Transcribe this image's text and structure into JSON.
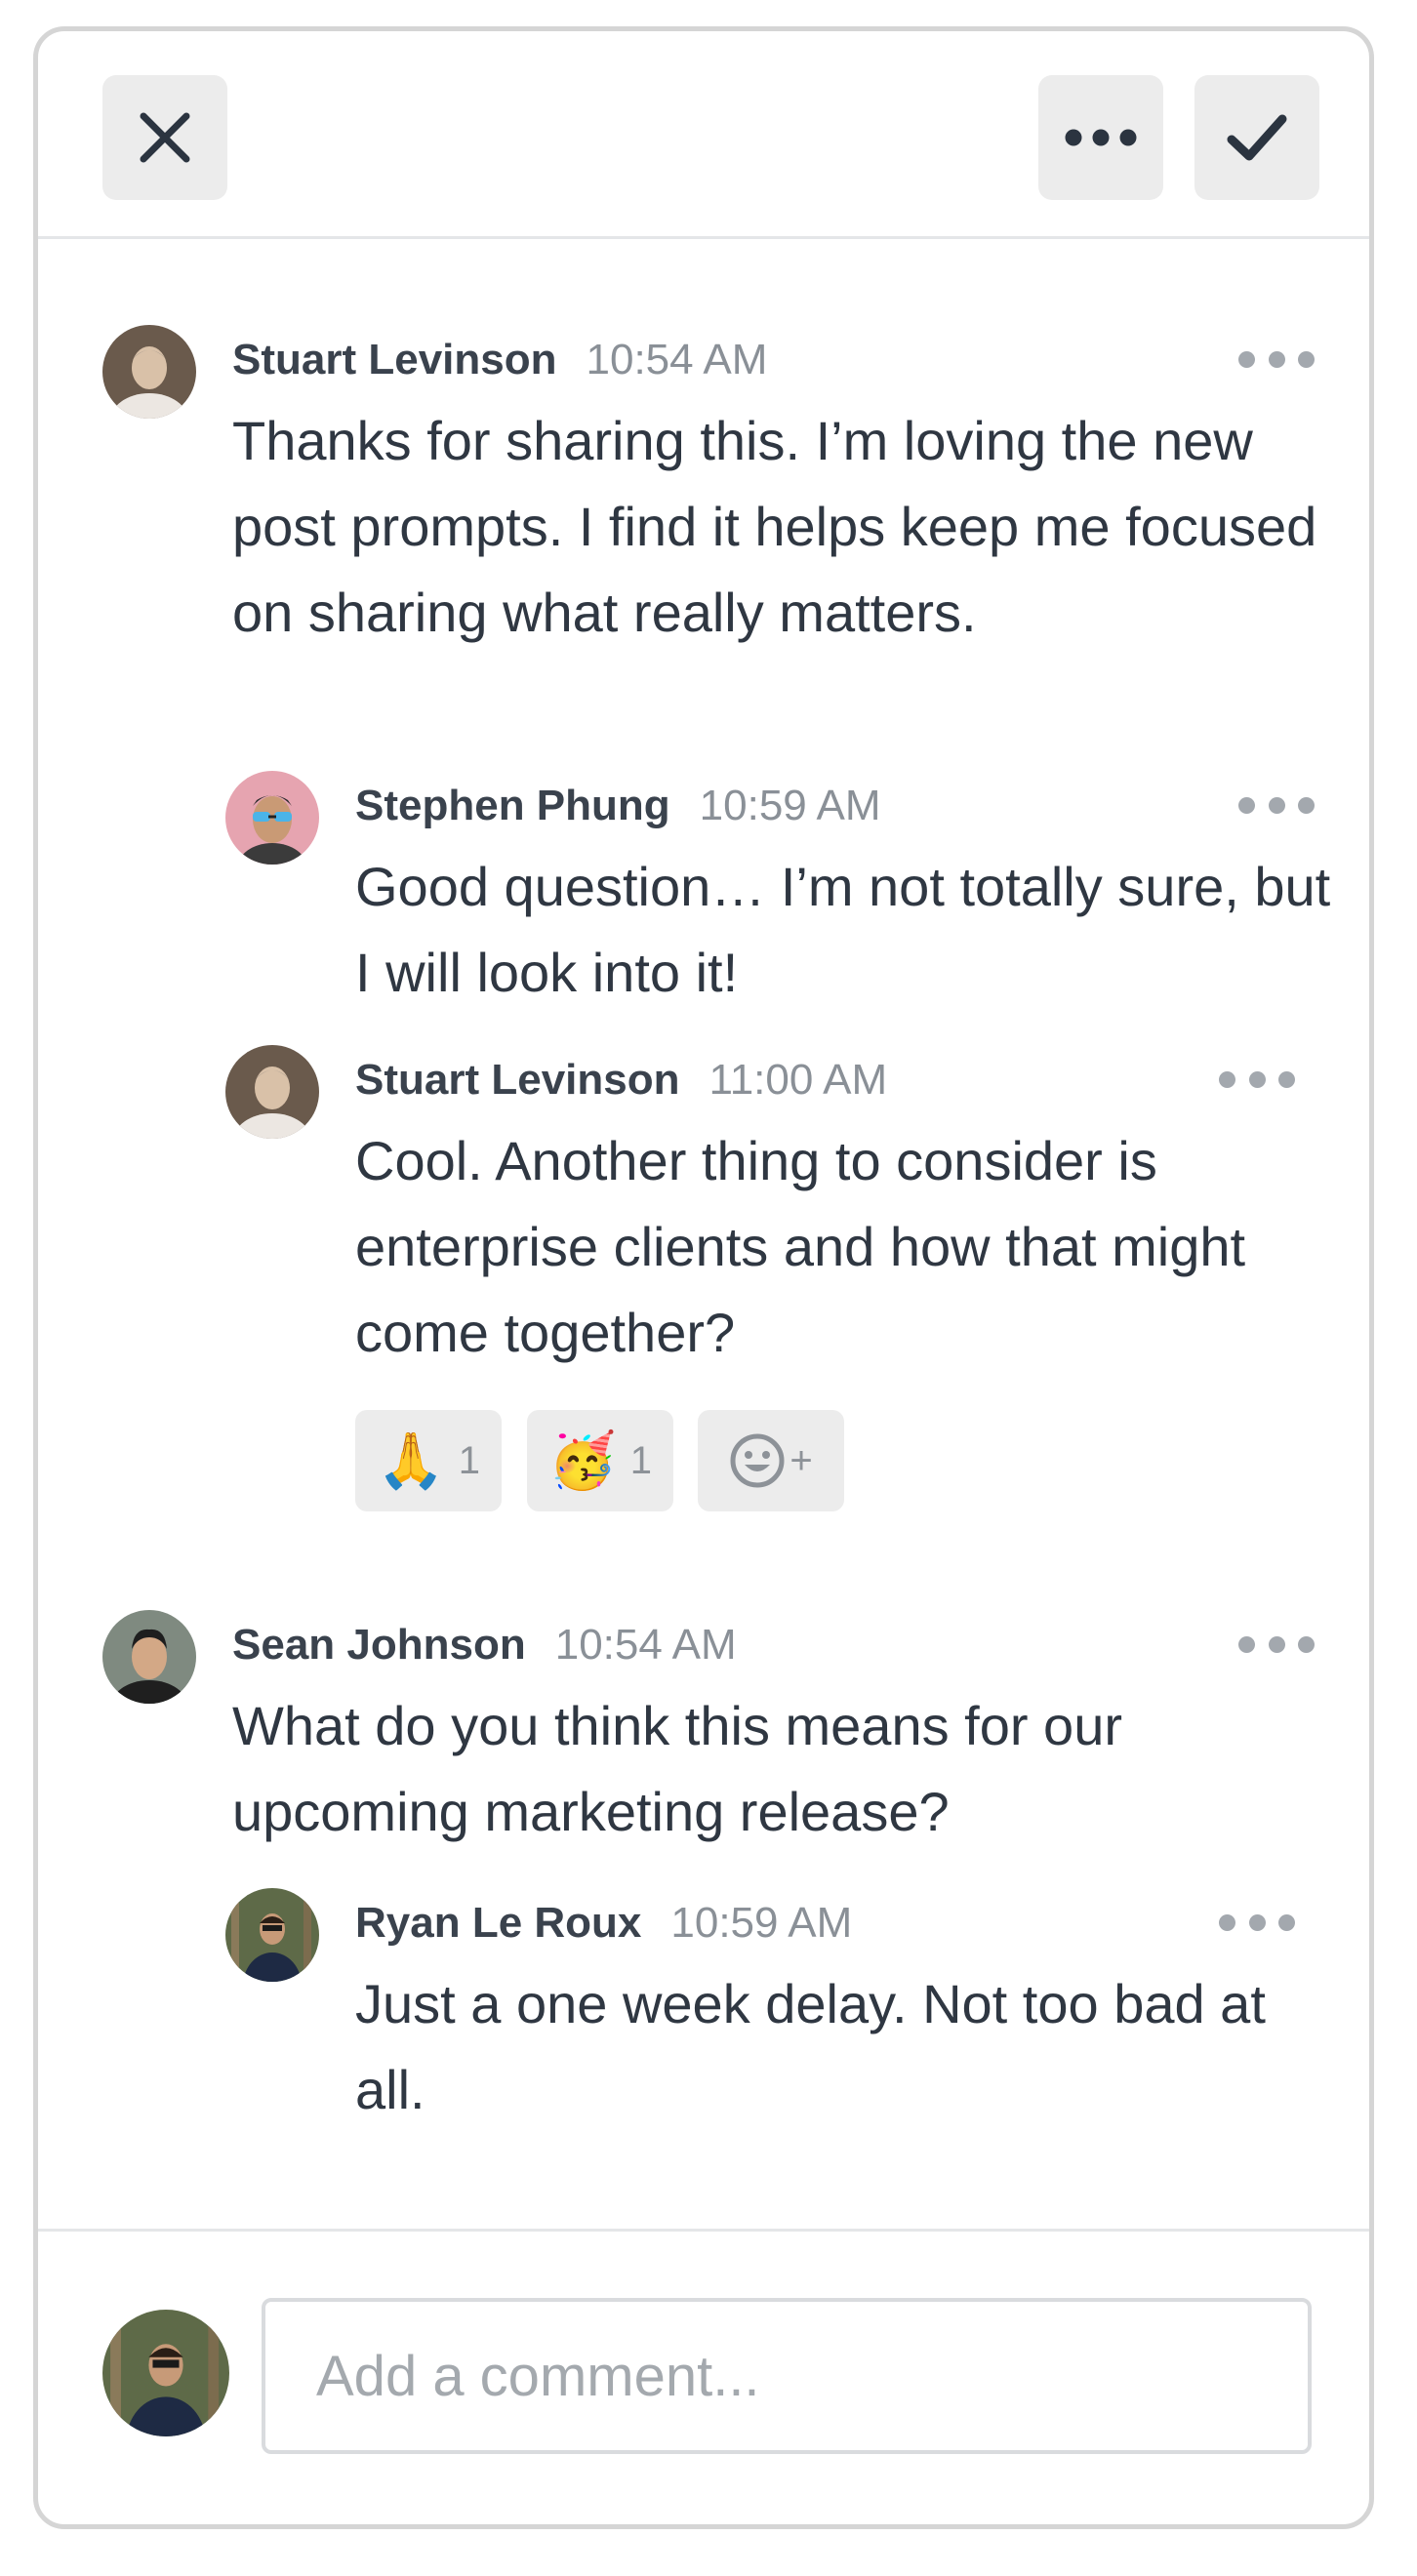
{
  "header": {
    "close_icon": "close-icon",
    "more_icon": "more-horizontal-icon",
    "check_icon": "check-icon"
  },
  "comments": [
    {
      "author": "Stuart Levinson",
      "time": "10:54 AM",
      "text": "Thanks for sharing this. I’m loving the new post prompts. I find it helps keep me focused on sharing what really matters.",
      "replies": [
        {
          "author": "Stephen Phung",
          "time": "10:59 AM",
          "text": "Good question… I’m not totally sure, but I will look into it!"
        },
        {
          "author": "Stuart Levinson",
          "time": "11:00 AM",
          "text": "Cool. Another thing to consider is enterprise clients and how that might come together?",
          "reactions": [
            {
              "emoji": "🙏",
              "count": "1"
            },
            {
              "emoji": "🥳",
              "count": "1"
            }
          ],
          "add_reaction_plus": "+"
        }
      ]
    },
    {
      "author": "Sean Johnson",
      "time": "10:54 AM",
      "text": "What do you think this means for our upcoming marketing release?",
      "replies": [
        {
          "author": "Ryan Le Roux",
          "time": "10:59 AM",
          "text": "Just a one week delay. Not too bad at all."
        }
      ]
    }
  ],
  "composer": {
    "placeholder": "Add a comment..."
  },
  "colors": {
    "button_bg": "#ececec",
    "icon_dark": "#2b3440",
    "muted_text": "#8a9097",
    "divider": "#e4e6e8"
  }
}
